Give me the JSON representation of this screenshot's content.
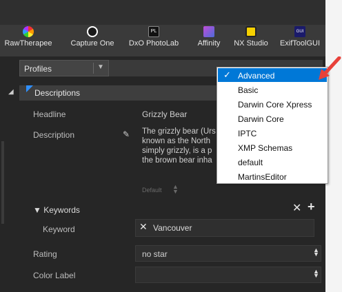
{
  "apps": [
    {
      "label": "RawTherapee",
      "icon": "rawtherapee-icon",
      "color": "#f0a020"
    },
    {
      "label": "Capture One",
      "icon": "capture-one-icon",
      "color": "#ffffff"
    },
    {
      "label": "DxO PhotoLab",
      "icon": "dxo-photolab-icon",
      "color": "#1e1e1e",
      "glyph": "PL"
    },
    {
      "label": "Affinity",
      "icon": "affinity-icon",
      "color": "#7e4dd8"
    },
    {
      "label": "NX Studio",
      "icon": "nx-studio-icon",
      "color": "#f5d000"
    },
    {
      "label": "ExifToolGUI",
      "icon": "exiftoolgui-icon",
      "color": "#ffffff",
      "glyph": "GUI"
    }
  ],
  "profiles": {
    "label": "Profiles"
  },
  "section": {
    "title": "Descriptions"
  },
  "fields": {
    "headline": {
      "label": "Headline",
      "value": "Grizzly Bear"
    },
    "description": {
      "label": "Description",
      "lines": [
        "The grizzly bear (Urs",
        "known as the North",
        "simply grizzly, is a p",
        "the brown bear inha"
      ],
      "default_label": "Default"
    },
    "keywords": {
      "label": "Keywords",
      "keyword_label": "Keyword",
      "value": "Vancouver"
    },
    "rating": {
      "label": "Rating",
      "value": "no star"
    },
    "color_label": {
      "label": "Color Label",
      "value": ""
    }
  },
  "dropdown": {
    "items": [
      "Advanced",
      "Basic",
      "Darwin Core Xpress",
      "Darwin Core",
      "IPTC",
      "XMP Schemas",
      "default",
      "MartinsEditor"
    ],
    "selected": "Advanced"
  },
  "colors": {
    "accent": "#0078d7",
    "annotation_arrow": "#e8413a",
    "panel": "#262626"
  }
}
